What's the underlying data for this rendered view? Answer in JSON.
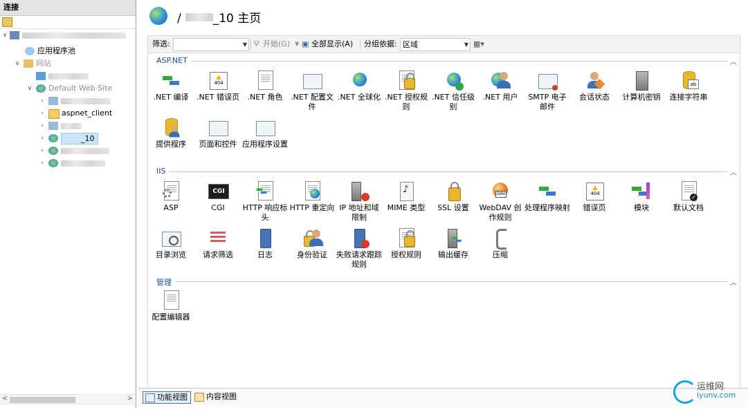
{
  "left": {
    "header": "连接",
    "tree": [
      {
        "label": "",
        "blurred": true
      },
      {
        "label": "应用程序池"
      },
      {
        "label": "网站"
      },
      {
        "label": "",
        "blurred": true
      },
      {
        "label": "Default Web Site"
      },
      {
        "label": "",
        "blurred": true
      },
      {
        "label": "aspnet_client"
      },
      {
        "label": "",
        "blurred": true
      },
      {
        "label": "_10",
        "selected": true
      },
      {
        "label": "",
        "blurred": true
      },
      {
        "label": "",
        "blurred": true
      }
    ]
  },
  "title": {
    "prefix": "/",
    "suffix": "_10 主页"
  },
  "filterbar": {
    "filter_label": "筛选:",
    "start": "开始(G)",
    "show_all": "全部显示(A)",
    "group_by_label": "分组依据:",
    "group_by_value": "区域"
  },
  "sections": [
    {
      "name": "ASP.NET",
      "items": [
        {
          "label": ".NET 编译",
          "icon": "compile-icon"
        },
        {
          "label": ".NET 错误页",
          "icon": "error-page-icon"
        },
        {
          "label": ".NET 角色",
          "icon": "roles-icon"
        },
        {
          "label": ".NET 配置文件",
          "icon": "profile-icon"
        },
        {
          "label": ".NET 全球化",
          "icon": "globalization-icon"
        },
        {
          "label": ".NET 授权规则",
          "icon": "authorization-icon"
        },
        {
          "label": ".NET 信任级别",
          "icon": "trust-level-icon"
        },
        {
          "label": ".NET 用户",
          "icon": "users-icon"
        },
        {
          "label": "SMTP 电子邮件",
          "icon": "smtp-icon"
        },
        {
          "label": "会话状态",
          "icon": "session-state-icon"
        },
        {
          "label": "计算机密钥",
          "icon": "machine-key-icon"
        },
        {
          "label": "连接字符串",
          "icon": "connection-string-icon"
        },
        {
          "label": "提供程序",
          "icon": "providers-icon"
        },
        {
          "label": "页面和控件",
          "icon": "pages-controls-icon"
        },
        {
          "label": "应用程序设置",
          "icon": "app-settings-icon"
        }
      ]
    },
    {
      "name": "IIS",
      "items": [
        {
          "label": "ASP",
          "icon": "asp-icon"
        },
        {
          "label": "CGI",
          "icon": "cgi-icon"
        },
        {
          "label": "HTTP 响应标头",
          "icon": "http-headers-icon"
        },
        {
          "label": "HTTP 重定向",
          "icon": "http-redirect-icon"
        },
        {
          "label": "IP 地址和域限制",
          "icon": "ip-restrictions-icon"
        },
        {
          "label": "MIME 类型",
          "icon": "mime-icon"
        },
        {
          "label": "SSL 设置",
          "icon": "ssl-icon"
        },
        {
          "label": "WebDAV 创作规则",
          "icon": "webdav-icon"
        },
        {
          "label": "处理程序映射",
          "icon": "handler-mappings-icon"
        },
        {
          "label": "错误页",
          "icon": "error-pages-icon"
        },
        {
          "label": "模块",
          "icon": "modules-icon"
        },
        {
          "label": "默认文档",
          "icon": "default-document-icon"
        },
        {
          "label": "目录浏览",
          "icon": "directory-browsing-icon"
        },
        {
          "label": "请求筛选",
          "icon": "request-filtering-icon"
        },
        {
          "label": "日志",
          "icon": "logging-icon"
        },
        {
          "label": "身份验证",
          "icon": "authentication-icon"
        },
        {
          "label": "失败请求跟踪规则",
          "icon": "failed-request-icon"
        },
        {
          "label": "授权规则",
          "icon": "authorization-rules-icon"
        },
        {
          "label": "输出缓存",
          "icon": "output-caching-icon"
        },
        {
          "label": "压缩",
          "icon": "compression-icon"
        }
      ]
    },
    {
      "name": "管理",
      "items": [
        {
          "label": "配置编辑器",
          "icon": "config-editor-icon"
        }
      ]
    }
  ],
  "bottom": {
    "features_view": "功能视图",
    "content_view": "内容视图"
  },
  "watermark": {
    "line1": "运维网",
    "line2": "iyunv.com"
  }
}
